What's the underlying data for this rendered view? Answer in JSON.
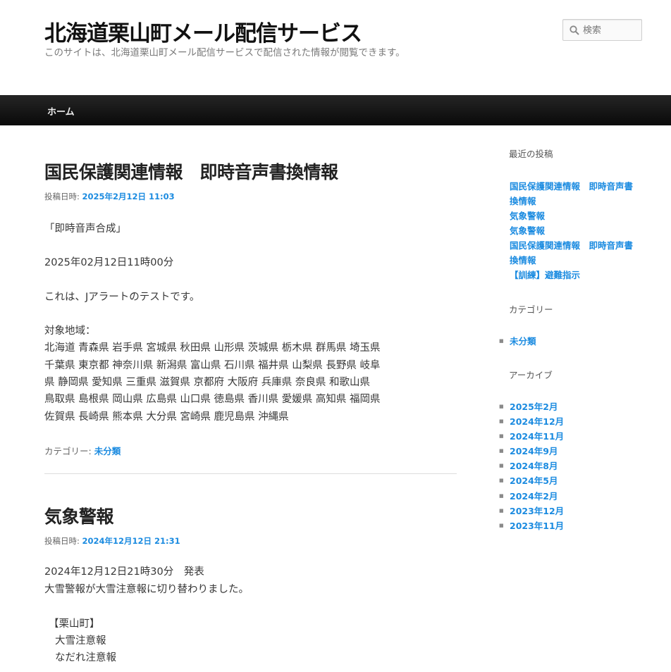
{
  "header": {
    "site_title": "北海道栗山町メール配信サービス",
    "site_description": "このサイトは、北海道栗山町メール配信サービスで配信された情報が閲覧できます。",
    "search_placeholder": "検索",
    "search_icon": "search-icon"
  },
  "nav": {
    "home_label": "ホーム"
  },
  "posts": [
    {
      "title": "国民保護関連情報　即時音声書換情報",
      "meta_label": "投稿日時:",
      "date": "2025年2月12日 11:03",
      "lines": [
        "「即時音声合成」",
        "2025年02月12日11時00分",
        "これは、Jアラートのテストです。",
        "対象地域：",
        "北海道 青森県 岩手県 宮城県 秋田県 山形県 茨城県 栃木県 群馬県 埼玉県",
        "千葉県 東京都 神奈川県 新潟県 富山県 石川県 福井県 山梨県 長野県 岐阜",
        "県 静岡県 愛知県 三重県 滋賀県 京都府 大阪府 兵庫県 奈良県 和歌山県",
        "鳥取県 島根県 岡山県 広島県 山口県 徳島県 香川県 愛媛県 高知県 福岡県",
        "佐賀県 長崎県 熊本県 大分県 宮崎県 鹿児島県 沖縄県"
      ],
      "category_label": "カテゴリー:",
      "category": "未分類"
    },
    {
      "title": "気象警報",
      "meta_label": "投稿日時:",
      "date": "2024年12月12日 21:31",
      "lines": [
        "2024年12月12日21時30分　発表",
        "大雪警報が大雪注意報に切り替わりました。",
        "【栗山町】",
        "大雪注意報",
        "なだれ注意報"
      ]
    }
  ],
  "sidebar": {
    "recent_title": "最近の投稿",
    "recent_posts": [
      "国民保護関連情報　即時音声書",
      "換情報",
      "気象警報",
      "気象警報",
      "国民保護関連情報　即時音声書",
      "換情報",
      "【訓練】避難指示"
    ],
    "categories_title": "カテゴリー",
    "categories": [
      "未分類"
    ],
    "archives_title": "アーカイブ",
    "archives": [
      "2025年2月",
      "2024年12月",
      "2024年11月",
      "2024年9月",
      "2024年8月",
      "2024年5月",
      "2024年2月",
      "2023年12月",
      "2023年11月"
    ]
  }
}
